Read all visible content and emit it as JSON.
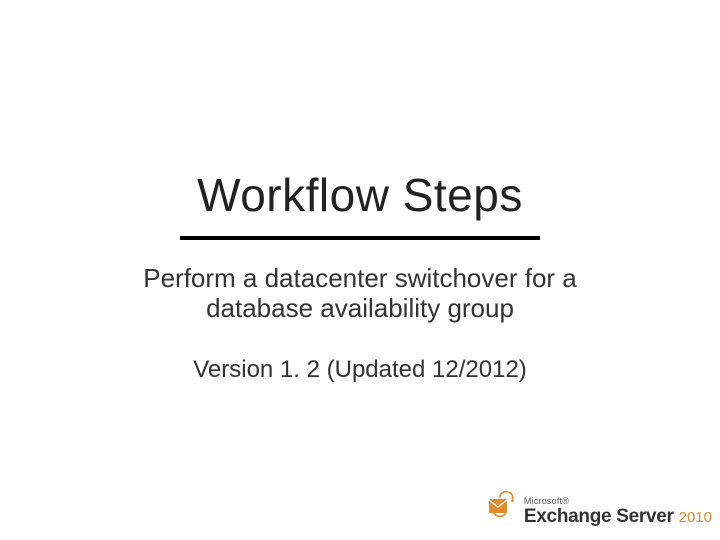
{
  "title": "Workflow Steps",
  "subtitle": "Perform a datacenter switchover for a database availability group",
  "version": "Version 1. 2 (Updated 12/2012)",
  "logo": {
    "brand": "Microsoft®",
    "product": "Exchange Server",
    "year": "2010"
  }
}
